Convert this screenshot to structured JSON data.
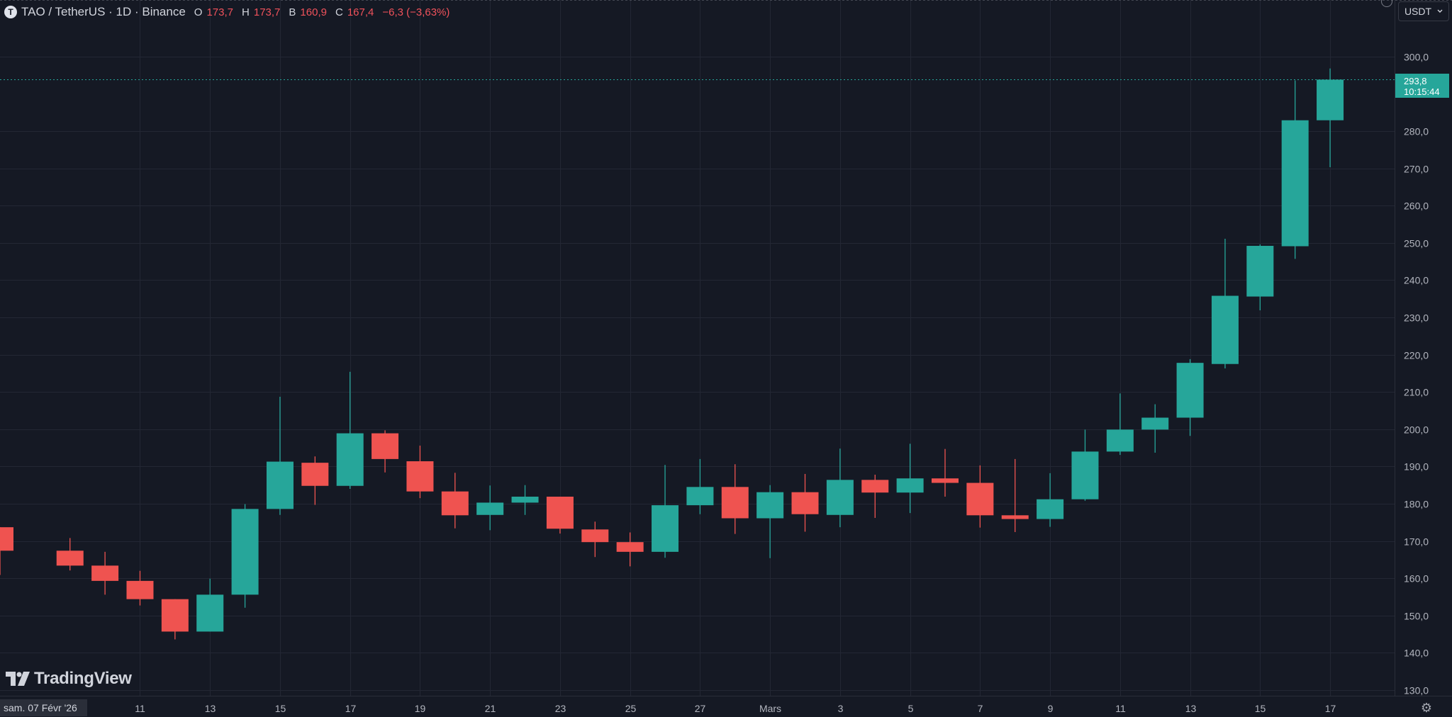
{
  "header": {
    "symbol": "TAO / TetherUS",
    "interval": "1D",
    "exchange": "Binance",
    "title": "TAO / TetherUS · 1D · Binance",
    "logo_letter": "T",
    "open_label": "O",
    "open_value": "173,7",
    "high_label": "H",
    "high_value": "173,7",
    "low_label": "B",
    "low_value": "160,9",
    "close_label": "C",
    "close_value": "167,4",
    "change": "−6,3 (−3,63%)"
  },
  "currency_selector": {
    "value": "USDT",
    "icon": "chevron-down-icon"
  },
  "last_price": {
    "value": "293,8",
    "countdown": "10:15:44"
  },
  "cursor_date": "sam. 07 Févr '26",
  "branding": {
    "name": "TradingView"
  },
  "colors": {
    "background": "#151924",
    "up": "#26a69a",
    "down": "#ef5350",
    "grid": "#232734",
    "text": "#b2b5be"
  },
  "chart_data": {
    "type": "candlestick",
    "y_range": [
      130,
      305
    ],
    "y_ticks": [
      "300,0",
      "280,0",
      "270,0",
      "260,0",
      "250,0",
      "240,0",
      "230,0",
      "220,0",
      "210,0",
      "200,0",
      "190,0",
      "180,0",
      "170,0",
      "160,0",
      "150,0",
      "140,0",
      "130,0"
    ],
    "y_tick_values": [
      300,
      280,
      270,
      260,
      250,
      240,
      230,
      220,
      210,
      200,
      190,
      180,
      170,
      160,
      150,
      140,
      130
    ],
    "x_ticks": [
      {
        "label": "11",
        "date": "2026-02-11"
      },
      {
        "label": "13",
        "date": "2026-02-13"
      },
      {
        "label": "15",
        "date": "2026-02-15"
      },
      {
        "label": "17",
        "date": "2026-02-17"
      },
      {
        "label": "19",
        "date": "2026-02-19"
      },
      {
        "label": "21",
        "date": "2026-02-21"
      },
      {
        "label": "23",
        "date": "2026-02-23"
      },
      {
        "label": "25",
        "date": "2026-02-25"
      },
      {
        "label": "27",
        "date": "2026-02-27"
      },
      {
        "label": "Mars",
        "date": "2026-03-01"
      },
      {
        "label": "3",
        "date": "2026-03-03"
      },
      {
        "label": "5",
        "date": "2026-03-05"
      },
      {
        "label": "7",
        "date": "2026-03-07"
      },
      {
        "label": "9",
        "date": "2026-03-09"
      },
      {
        "label": "11",
        "date": "2026-03-11"
      },
      {
        "label": "13",
        "date": "2026-03-13"
      },
      {
        "label": "15",
        "date": "2026-03-15"
      },
      {
        "label": "17",
        "date": "2026-03-17"
      }
    ],
    "candles": [
      {
        "date": "2026-02-07",
        "open": 173.7,
        "high": 173.7,
        "low": 160.9,
        "close": 167.4
      },
      {
        "date": "2026-02-09",
        "open": 167.4,
        "high": 170.8,
        "low": 162.1,
        "close": 163.4
      },
      {
        "date": "2026-02-10",
        "open": 163.4,
        "high": 167.1,
        "low": 155.6,
        "close": 159.3
      },
      {
        "date": "2026-02-11",
        "open": 159.3,
        "high": 162.0,
        "low": 152.7,
        "close": 154.4
      },
      {
        "date": "2026-02-12",
        "open": 154.4,
        "high": 154.4,
        "low": 143.6,
        "close": 145.7
      },
      {
        "date": "2026-02-13",
        "open": 145.7,
        "high": 159.9,
        "low": 145.7,
        "close": 155.6
      },
      {
        "date": "2026-02-14",
        "open": 155.6,
        "high": 179.9,
        "low": 152.1,
        "close": 178.6
      },
      {
        "date": "2026-02-15",
        "open": 178.6,
        "high": 208.7,
        "low": 177.0,
        "close": 191.3
      },
      {
        "date": "2026-02-16",
        "open": 191.0,
        "high": 192.7,
        "low": 179.7,
        "close": 184.8
      },
      {
        "date": "2026-02-17",
        "open": 184.8,
        "high": 215.4,
        "low": 184.0,
        "close": 198.9
      },
      {
        "date": "2026-02-18",
        "open": 198.9,
        "high": 199.7,
        "low": 188.4,
        "close": 192.0
      },
      {
        "date": "2026-02-19",
        "open": 191.4,
        "high": 195.6,
        "low": 181.5,
        "close": 183.3
      },
      {
        "date": "2026-02-20",
        "open": 183.3,
        "high": 188.3,
        "low": 173.4,
        "close": 176.9
      },
      {
        "date": "2026-02-21",
        "open": 177.0,
        "high": 184.9,
        "low": 172.9,
        "close": 180.3
      },
      {
        "date": "2026-02-22",
        "open": 180.3,
        "high": 185.0,
        "low": 177.0,
        "close": 181.9
      },
      {
        "date": "2026-02-23",
        "open": 181.9,
        "high": 181.9,
        "low": 172.0,
        "close": 173.3
      },
      {
        "date": "2026-02-24",
        "open": 173.1,
        "high": 175.2,
        "low": 165.7,
        "close": 169.7
      },
      {
        "date": "2026-02-25",
        "open": 169.7,
        "high": 172.3,
        "low": 163.2,
        "close": 167.1
      },
      {
        "date": "2026-02-26",
        "open": 167.1,
        "high": 190.4,
        "low": 165.5,
        "close": 179.6
      },
      {
        "date": "2026-02-27",
        "open": 179.6,
        "high": 192.0,
        "low": 177.2,
        "close": 184.5
      },
      {
        "date": "2026-02-28",
        "open": 184.5,
        "high": 190.6,
        "low": 171.9,
        "close": 176.1
      },
      {
        "date": "2026-03-01",
        "open": 176.1,
        "high": 185.0,
        "low": 165.4,
        "close": 183.1
      },
      {
        "date": "2026-03-02",
        "open": 183.1,
        "high": 188.0,
        "low": 172.5,
        "close": 177.2
      },
      {
        "date": "2026-03-03",
        "open": 177.0,
        "high": 194.8,
        "low": 173.7,
        "close": 186.4
      },
      {
        "date": "2026-03-04",
        "open": 186.4,
        "high": 187.8,
        "low": 176.2,
        "close": 183.0
      },
      {
        "date": "2026-03-05",
        "open": 183.0,
        "high": 196.1,
        "low": 177.5,
        "close": 186.8
      },
      {
        "date": "2026-03-06",
        "open": 186.8,
        "high": 194.7,
        "low": 181.9,
        "close": 185.6
      },
      {
        "date": "2026-03-07",
        "open": 185.6,
        "high": 190.3,
        "low": 173.6,
        "close": 176.9
      },
      {
        "date": "2026-03-08",
        "open": 176.9,
        "high": 192.0,
        "low": 172.4,
        "close": 175.9
      },
      {
        "date": "2026-03-09",
        "open": 175.9,
        "high": 188.2,
        "low": 173.8,
        "close": 181.2
      },
      {
        "date": "2026-03-10",
        "open": 181.2,
        "high": 199.9,
        "low": 180.8,
        "close": 194.0
      },
      {
        "date": "2026-03-11",
        "open": 194.0,
        "high": 209.6,
        "low": 193.1,
        "close": 199.9
      },
      {
        "date": "2026-03-12",
        "open": 199.9,
        "high": 206.7,
        "low": 193.7,
        "close": 203.1
      },
      {
        "date": "2026-03-13",
        "open": 203.1,
        "high": 218.8,
        "low": 198.2,
        "close": 217.8
      },
      {
        "date": "2026-03-14",
        "open": 217.5,
        "high": 251.1,
        "low": 216.3,
        "close": 235.8
      },
      {
        "date": "2026-03-15",
        "open": 235.6,
        "high": 249.6,
        "low": 231.9,
        "close": 249.2
      },
      {
        "date": "2026-03-16",
        "open": 249.1,
        "high": 293.6,
        "low": 245.7,
        "close": 282.9
      },
      {
        "date": "2026-03-17",
        "open": 282.9,
        "high": 296.8,
        "low": 270.3,
        "close": 293.8
      }
    ]
  }
}
